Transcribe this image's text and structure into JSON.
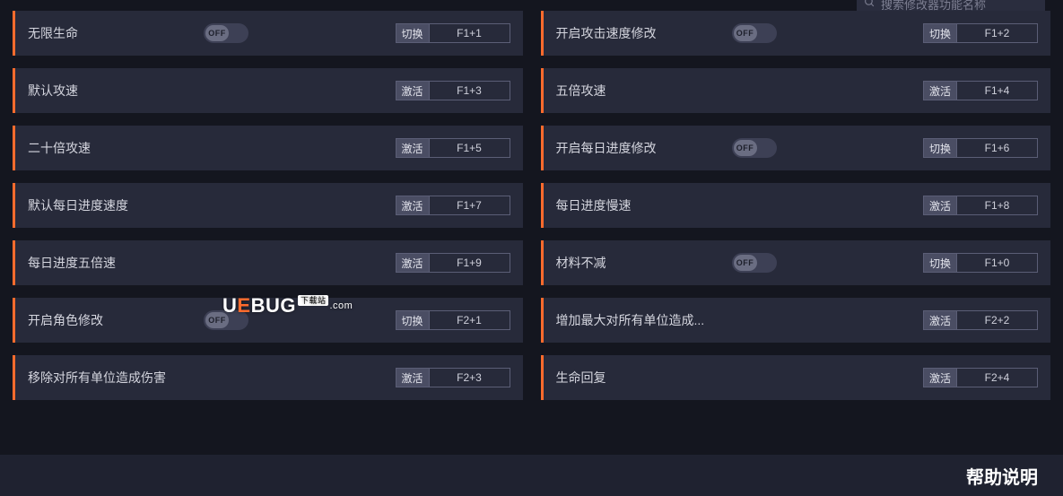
{
  "search_placeholder": "搜索修改器功能名称",
  "toggle_off_label": "OFF",
  "action_switch": "切换",
  "action_activate": "激活",
  "watermark": {
    "brand": "UEBUG",
    "tag": "下载站",
    "suffix": ".com"
  },
  "footer": "帮助说明",
  "left": [
    {
      "name": "无限生命",
      "toggle": true,
      "action": "switch",
      "hotkey": "F1+1"
    },
    {
      "name": "默认攻速",
      "toggle": false,
      "action": "activate",
      "hotkey": "F1+3"
    },
    {
      "name": "二十倍攻速",
      "toggle": false,
      "action": "activate",
      "hotkey": "F1+5"
    },
    {
      "name": "默认每日进度速度",
      "toggle": false,
      "action": "activate",
      "hotkey": "F1+7"
    },
    {
      "name": "每日进度五倍速",
      "toggle": false,
      "action": "activate",
      "hotkey": "F1+9"
    },
    {
      "name": "开启角色修改",
      "toggle": true,
      "action": "switch",
      "hotkey": "F2+1"
    },
    {
      "name": "移除对所有单位造成伤害",
      "toggle": false,
      "action": "activate",
      "hotkey": "F2+3"
    }
  ],
  "right": [
    {
      "name": "开启攻击速度修改",
      "toggle": true,
      "action": "switch",
      "hotkey": "F1+2"
    },
    {
      "name": "五倍攻速",
      "toggle": false,
      "action": "activate",
      "hotkey": "F1+4"
    },
    {
      "name": "开启每日进度修改",
      "toggle": true,
      "action": "switch",
      "hotkey": "F1+6"
    },
    {
      "name": "每日进度慢速",
      "toggle": false,
      "action": "activate",
      "hotkey": "F1+8"
    },
    {
      "name": "材料不减",
      "toggle": true,
      "action": "switch",
      "hotkey": "F1+0"
    },
    {
      "name": "增加最大对所有单位造成...",
      "toggle": false,
      "action": "activate",
      "hotkey": "F2+2"
    },
    {
      "name": "生命回复",
      "toggle": false,
      "action": "activate",
      "hotkey": "F2+4"
    }
  ]
}
